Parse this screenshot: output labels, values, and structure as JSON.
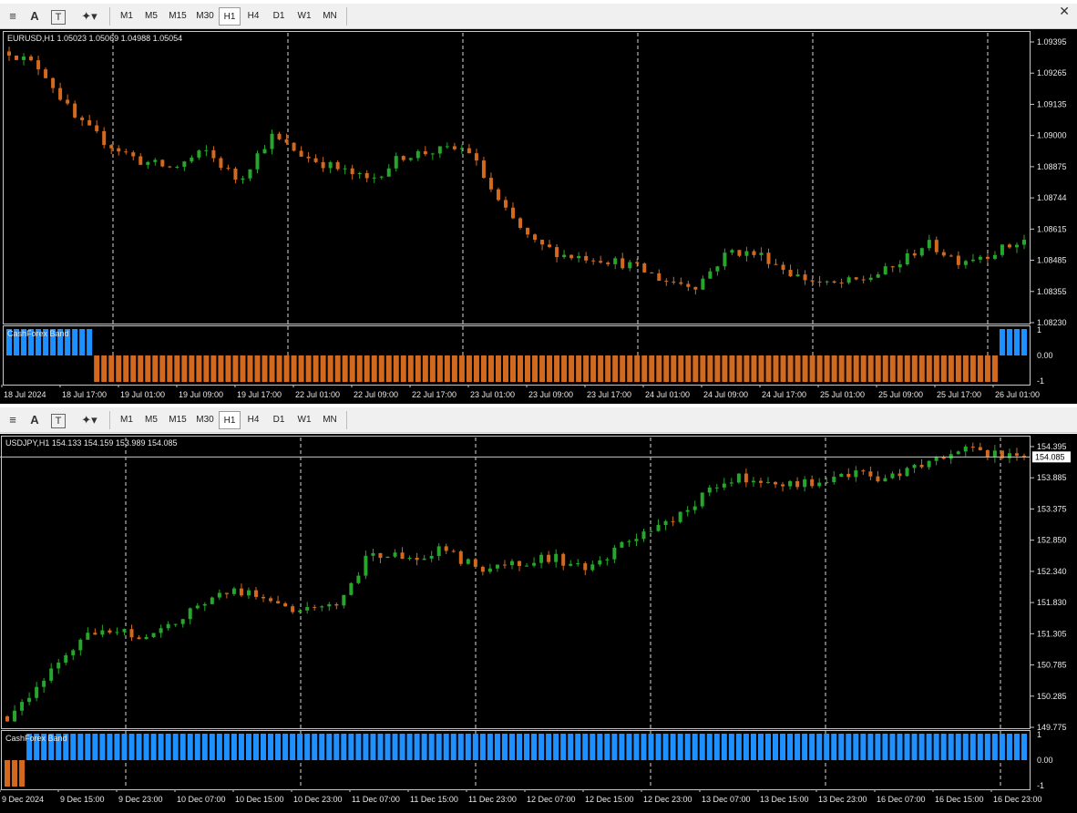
{
  "toolbar": {
    "timeframes": [
      "M1",
      "M5",
      "M15",
      "M30",
      "H1",
      "H4",
      "D1",
      "W1",
      "MN"
    ],
    "active": "H1",
    "icons": [
      "menu-lines-icon",
      "text-a-icon",
      "text-t-icon",
      "shapes-icon"
    ]
  },
  "colors": {
    "bull": "#26a62c",
    "bear": "#d2691e",
    "band_up": "#1e90ff",
    "band_down": "#d2691e",
    "grid": "#ffffff",
    "axis_text": "#e8e8e8"
  },
  "chart1": {
    "title": "EURUSD,H1  1.05023 1.05069 1.04988 1.05054",
    "y_ticks": [
      "1.09395",
      "1.09265",
      "1.09135",
      "1.09000",
      "1.08875",
      "1.08744",
      "1.08615",
      "1.08485",
      "1.08355",
      "1.08230"
    ],
    "y_range": [
      1.0823,
      1.09395
    ],
    "x_labels": [
      "18 Jul 2024",
      "18 Jul 17:00",
      "19 Jul 01:00",
      "19 Jul 09:00",
      "19 Jul 17:00",
      "22 Jul 01:00",
      "22 Jul 09:00",
      "22 Jul 17:00",
      "23 Jul 01:00",
      "23 Jul 09:00",
      "23 Jul 17:00",
      "24 Jul 01:00",
      "24 Jul 09:00",
      "24 Jul 17:00",
      "25 Jul 01:00",
      "25 Jul 09:00",
      "25 Jul 17:00",
      "26 Jul 01:00"
    ],
    "indicator": {
      "name": "CashForex Band",
      "ticks": [
        "1",
        "0.00",
        "-1"
      ]
    }
  },
  "chart2": {
    "title": "USDJPY,H1  154.133 154.159 153.989 154.085",
    "y_ticks": [
      "154.395",
      "153.885",
      "153.375",
      "152.850",
      "152.340",
      "151.830",
      "151.305",
      "150.785",
      "150.285",
      "149.775"
    ],
    "y_range": [
      149.775,
      154.395
    ],
    "current_price": "154.085",
    "x_labels": [
      "9 Dec 2024",
      "9 Dec 15:00",
      "9 Dec 23:00",
      "10 Dec 07:00",
      "10 Dec 15:00",
      "10 Dec 23:00",
      "11 Dec 07:00",
      "11 Dec 15:00",
      "11 Dec 23:00",
      "12 Dec 07:00",
      "12 Dec 15:00",
      "12 Dec 23:00",
      "13 Dec 07:00",
      "13 Dec 15:00",
      "13 Dec 23:00",
      "16 Dec 07:00",
      "16 Dec 15:00",
      "16 Dec 23:00"
    ],
    "indicator": {
      "name": "CashForex Band",
      "ticks": [
        "1",
        "0.00",
        "-1"
      ]
    }
  }
}
